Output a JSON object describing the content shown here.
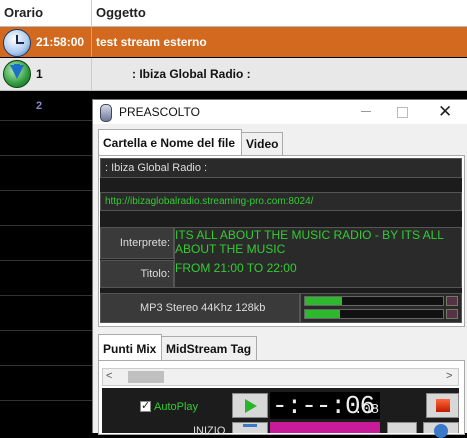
{
  "schedule": {
    "col_time": "Orario",
    "col_object": "Oggetto",
    "row1": {
      "time": "21:58:00",
      "title": "test stream esterno"
    },
    "row2": {
      "num": "1",
      "title": ": Ibiza Global Radio :"
    },
    "row3": {
      "num": "2"
    }
  },
  "dialog": {
    "title": "PREASCOLTO",
    "close_glyph": "✕",
    "tabs": {
      "file": "Cartella e Nome del file",
      "video": "Video"
    },
    "station": ": Ibiza Global Radio :",
    "url": "http://ibizaglobalradio.streaming-pro.com:8024/",
    "interprete_label": "Interprete:",
    "interprete_value": "ITS ALL ABOUT THE MUSIC RADIO - BY ITS ALL ABOUT THE MUSIC",
    "titolo_label": "Titolo:",
    "titolo_value": "FROM 21:00 TO 22:00",
    "format": "MP3 Stereo 44Khz 128kb",
    "meter_levels": [
      0.27,
      0.25
    ],
    "tabs2": {
      "mix": "Punti Mix",
      "midstream": "MidStream Tag"
    },
    "scroll_left": "<",
    "scroll_right": ">",
    "autoplay_check": "✓",
    "autoplay_label": "AutoPlay",
    "counter_main": "-:--:06",
    "counter_frac": ".08",
    "inizio_label": "INIZIO"
  },
  "colors": {
    "accent_row": "#d2691e",
    "green_text": "#33cc33",
    "pink": "#c81b9a"
  }
}
